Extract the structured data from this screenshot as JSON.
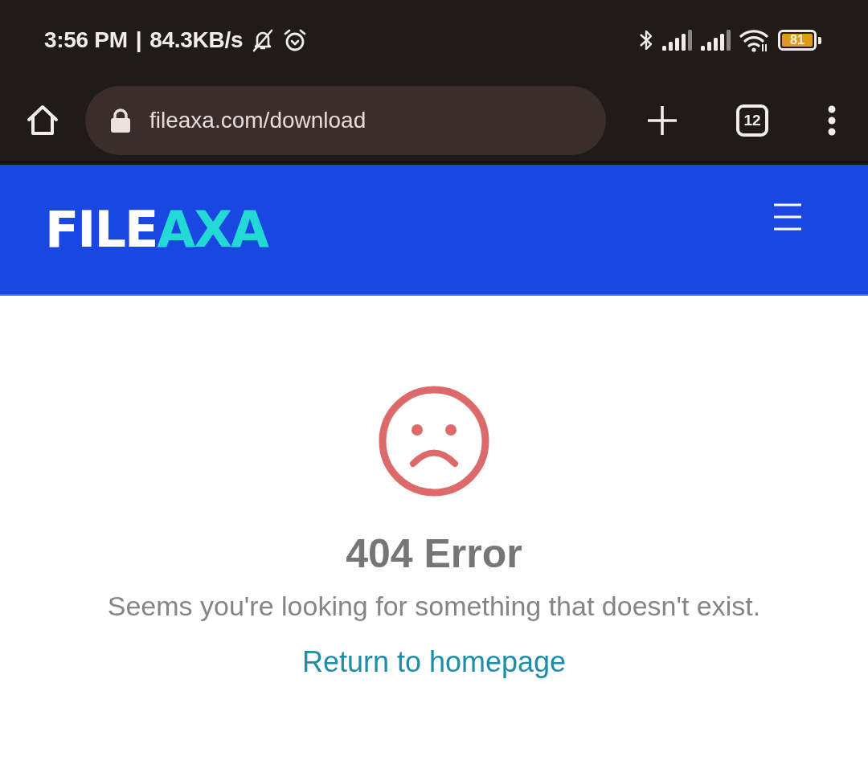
{
  "status_bar": {
    "time": "3:56 PM",
    "separator": "|",
    "speed": "84.3KB/s",
    "battery": "81"
  },
  "browser_toolbar": {
    "url": "fileaxa.com/download",
    "tab_count": "12"
  },
  "site_header": {
    "logo": [
      {
        "text": "FILE",
        "color": "#ffffff"
      },
      {
        "text": "AXA",
        "color": "#22d9d6"
      }
    ]
  },
  "error_page": {
    "title": "404 Error",
    "message": "Seems you're looking for something that doesn't exist.",
    "link": "Return to homepage"
  }
}
